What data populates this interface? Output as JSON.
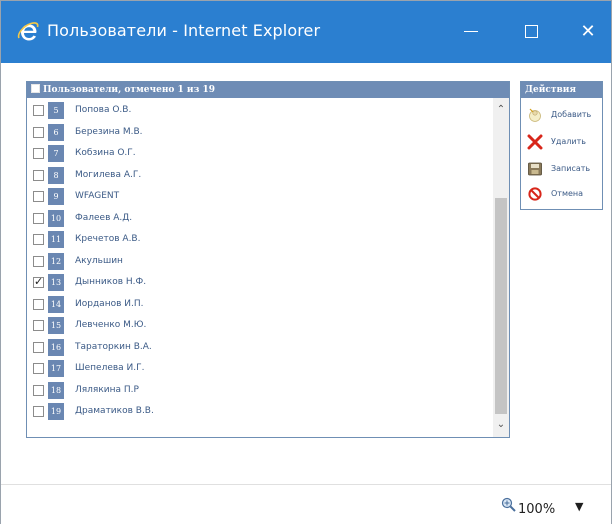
{
  "window": {
    "title": "Пользователи - Internet Explorer"
  },
  "users_panel": {
    "header": "Пользователи, отмечено 1 из 19",
    "rows": [
      {
        "num": "5",
        "name": "Попова О.В.",
        "checked": false
      },
      {
        "num": "6",
        "name": "Березина М.В.",
        "checked": false
      },
      {
        "num": "7",
        "name": "Кобзина О.Г.",
        "checked": false
      },
      {
        "num": "8",
        "name": "Могилева А.Г.",
        "checked": false
      },
      {
        "num": "9",
        "name": "WFAGENT",
        "checked": false
      },
      {
        "num": "10",
        "name": "Фалеев А.Д.",
        "checked": false
      },
      {
        "num": "11",
        "name": "Кречетов А.В.",
        "checked": false
      },
      {
        "num": "12",
        "name": "Акульшин",
        "checked": false
      },
      {
        "num": "13",
        "name": "Дынников Н.Ф.",
        "checked": true
      },
      {
        "num": "14",
        "name": "Иорданов И.П.",
        "checked": false
      },
      {
        "num": "15",
        "name": "Левченко М.Ю.",
        "checked": false
      },
      {
        "num": "16",
        "name": "Тараторкин В.А.",
        "checked": false
      },
      {
        "num": "17",
        "name": "Шепелева И.Г.",
        "checked": false
      },
      {
        "num": "18",
        "name": "Лялякина П.Р",
        "checked": false
      },
      {
        "num": "19",
        "name": "Драматиков В.В.",
        "checked": false
      }
    ]
  },
  "actions_panel": {
    "header": "Действия",
    "items": [
      {
        "label": "Добавить",
        "icon": "add-user-icon"
      },
      {
        "label": "Удалить",
        "icon": "delete-icon"
      },
      {
        "label": "Записать",
        "icon": "save-icon"
      },
      {
        "label": "Отмена",
        "icon": "cancel-icon"
      }
    ]
  },
  "status_bar": {
    "zoom": "100%"
  },
  "colors": {
    "titlebar": "#2b7fd0",
    "panel_header": "#6e8cb5",
    "number_badge": "#6a87b2",
    "link_text": "#3b5a86"
  }
}
